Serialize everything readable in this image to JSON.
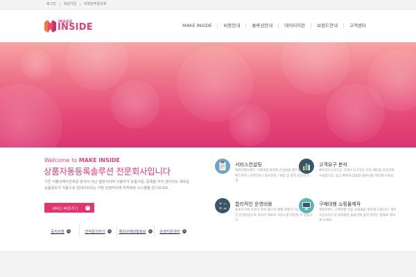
{
  "topbar": {
    "links": [
      "로그인",
      "회원가입",
      "비회원주문조회"
    ]
  },
  "header": {
    "logo_make": "MAKE",
    "logo_inside": "INSIDE",
    "nav": [
      "MAKE INSIDE",
      "비용안내",
      "솔루션안내",
      "데이터이전",
      "브랜드안내",
      "고객센터"
    ]
  },
  "intro": {
    "welcome_prefix": "Welcome to ",
    "welcome_brand": "MAKE INSIDE",
    "headline": "상품자동등록솔루션 전문회사입니다",
    "description": "기존 어플리케이션제공 방식이 아닌 웹방식이며 사용자가 상품수집, 등록을 하지 않더라도 새로운 상품정보가 자동으로 업데이트되는 가장 안정적이며 최적화된 시스템을 만나보세요.",
    "cta_label": "서비스 바로가기",
    "cta_arrow": "›"
  },
  "sublinks": [
    {
      "label": "공지사항",
      "go": "›"
    },
    {
      "label": "견적문의하기",
      "go": "›"
    },
    {
      "label": "해외구매대행정보",
      "go": "›"
    },
    {
      "label": "운영지원센터",
      "go": "›"
    }
  ],
  "services": [
    {
      "title": "서비스컨설팅",
      "desc": "해외유명브랜드 구매대행 최적화 컨설팅을 해드립니다. 브랜드추천 / 운영전략 / 홍보전략 / 배송 및 현지 담당자 소개",
      "icon": "clipboard-icon",
      "color": "#6aa4cf"
    },
    {
      "title": "고객요구 분석",
      "desc": "메이크인사이드는 고객이 요구하는 모든 패턴을 분석하여 수용합니다. 쉽고 빠르게 맞춤형 솔루션을 제작해 보세요.",
      "icon": "bar-chart-icon",
      "color": "#3a5565"
    },
    {
      "title": "합리적인 운영비용",
      "desc": "솔루션구매 비용이 따로 없으며 월별 결제가 가능한 합리적인 운영비용으로 최저가 제로로 서비스를 이용할 수 있습니다.",
      "icon": "calculator-icon",
      "color": "#3a5565"
    },
    {
      "title": "구매대행 쇼핑몰제작",
      "desc": "해외브랜드 구매대행 전용 쇼핑몰을 제작해 드립니다. 메이크인사이드의 최적화된 솔루션에 맞춰 원하는 형태로 제작해 보세요.",
      "icon": "monitor-icon",
      "color": "#5bb5b5"
    }
  ],
  "colors": {
    "brand": "#e8336f",
    "hero_top": "#f7a3a3",
    "hero_bottom": "#dc3470"
  }
}
